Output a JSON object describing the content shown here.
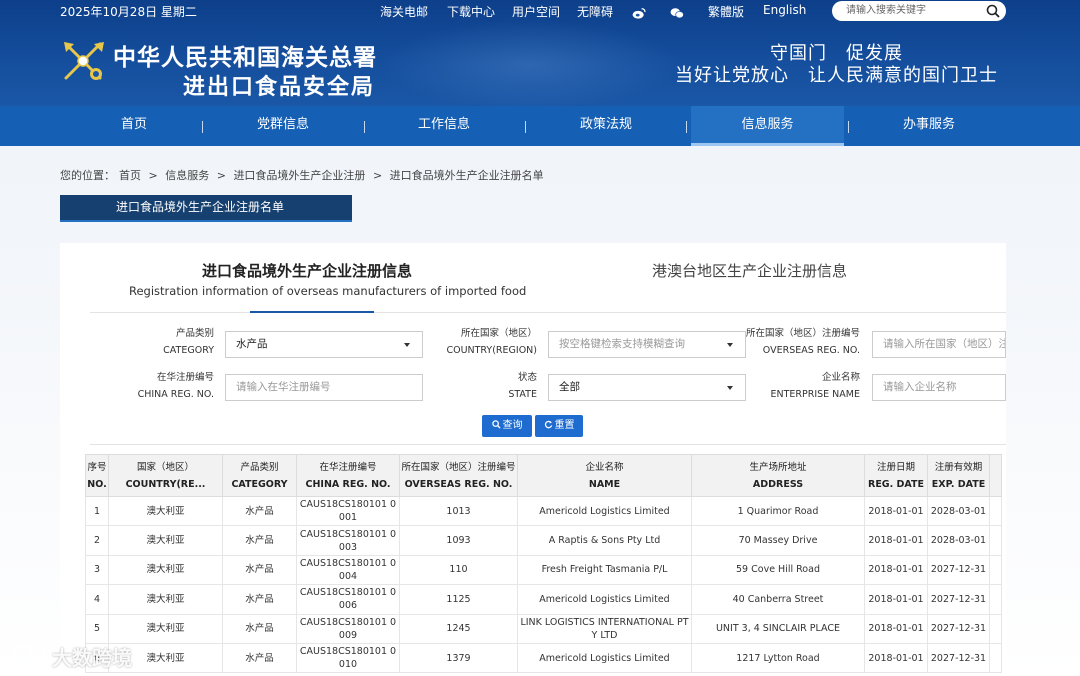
{
  "header": {
    "date": "2025年10月28日 星期二",
    "top_links": [
      "海关电邮",
      "下载中心",
      "用户空间",
      "无障碍",
      "繁體版",
      "English"
    ],
    "search_placeholder": "请输入搜索关键字",
    "title": "中华人民共和国海关总署",
    "subtitle": "进出口食品安全局",
    "slogan_line1": "守国门　促发展",
    "slogan_line2": "当好让党放心　让人民满意的国门卫士"
  },
  "nav": {
    "items": [
      "首页",
      "党群信息",
      "工作信息",
      "政策法规",
      "信息服务",
      "办事服务"
    ],
    "active": "信息服务"
  },
  "breadcrumb": {
    "prefix": "您的位置：",
    "items": [
      "首页",
      "信息服务",
      "进口食品境外生产企业注册",
      "进口食品境外生产企业注册名单"
    ],
    "separator": ">"
  },
  "section_tab": "进口食品境外生产企业注册名单",
  "tabs": {
    "tab1_cn": "进口食品境外生产企业注册信息",
    "tab1_en": "Registration information of overseas manufacturers of imported food",
    "tab2_cn": "港澳台地区生产企业注册信息"
  },
  "filters": {
    "category": {
      "label_cn": "产品类别",
      "label_en": "CATEGORY",
      "value": "水产品"
    },
    "country": {
      "label_cn": "所在国家（地区）",
      "label_en": "COUNTRY(REGION)",
      "placeholder": "按空格键检索支持模糊查询"
    },
    "overseas_reg": {
      "label_cn": "所在国家（地区）注册编号",
      "label_en": "OVERSEAS REG. NO.",
      "placeholder": "请输入所在国家（地区）注册编号"
    },
    "china_reg": {
      "label_cn": "在华注册编号",
      "label_en": "CHINA REG. NO.",
      "placeholder": "请输入在华注册编号"
    },
    "state": {
      "label_cn": "状态",
      "label_en": "STATE",
      "value": "全部"
    },
    "enterprise": {
      "label_cn": "企业名称",
      "label_en": "ENTERPRISE NAME",
      "placeholder": "请输入企业名称"
    }
  },
  "buttons": {
    "query": "查询",
    "reset": "重置"
  },
  "table": {
    "headers": [
      {
        "cn": "序号",
        "en": "NO."
      },
      {
        "cn": "国家（地区）",
        "en": "COUNTRY(RE..."
      },
      {
        "cn": "产品类别",
        "en": "CATEGORY"
      },
      {
        "cn": "在华注册编号",
        "en": "CHINA REG. NO."
      },
      {
        "cn": "所在国家（地区）注册编号",
        "en": "OVERSEAS REG. NO."
      },
      {
        "cn": "企业名称",
        "en": "NAME"
      },
      {
        "cn": "生产场所地址",
        "en": "ADDRESS"
      },
      {
        "cn": "注册日期",
        "en": "REG. DATE"
      },
      {
        "cn": "注册有效期",
        "en": "EXP. DATE"
      },
      {
        "cn": "",
        "en": ""
      }
    ],
    "rows": [
      [
        "1",
        "澳大利亚",
        "水产品",
        "CAUS18CS180101 0001",
        "1013",
        "Americold Logistics Limited",
        "1 Quarimor Road",
        "2018-01-01",
        "2028-03-01"
      ],
      [
        "2",
        "澳大利亚",
        "水产品",
        "CAUS18CS180101 0003",
        "1093",
        "A Raptis & Sons Pty Ltd",
        "70 Massey Drive",
        "2018-01-01",
        "2028-03-01"
      ],
      [
        "3",
        "澳大利亚",
        "水产品",
        "CAUS18CS180101 0004",
        "110",
        "Fresh Freight Tasmania P/L",
        "59 Cove Hill Road",
        "2018-01-01",
        "2027-12-31"
      ],
      [
        "4",
        "澳大利亚",
        "水产品",
        "CAUS18CS180101 0006",
        "1125",
        "Americold Logistics Limited",
        "40 Canberra Street",
        "2018-01-01",
        "2027-12-31"
      ],
      [
        "5",
        "澳大利亚",
        "水产品",
        "CAUS18CS180101 0009",
        "1245",
        "LINK LOGISTICS INTERNATIONAL PTY LTD",
        "UNIT 3, 4 SINCLAIR PLACE",
        "2018-01-01",
        "2027-12-31"
      ],
      [
        "6",
        "澳大利亚",
        "水产品",
        "CAUS18CS180101 0010",
        "1379",
        "Americold Logistics Limited",
        "1217 Lytton Road",
        "2018-01-01",
        "2027-12-31"
      ]
    ]
  },
  "watermark": "大数跨境"
}
